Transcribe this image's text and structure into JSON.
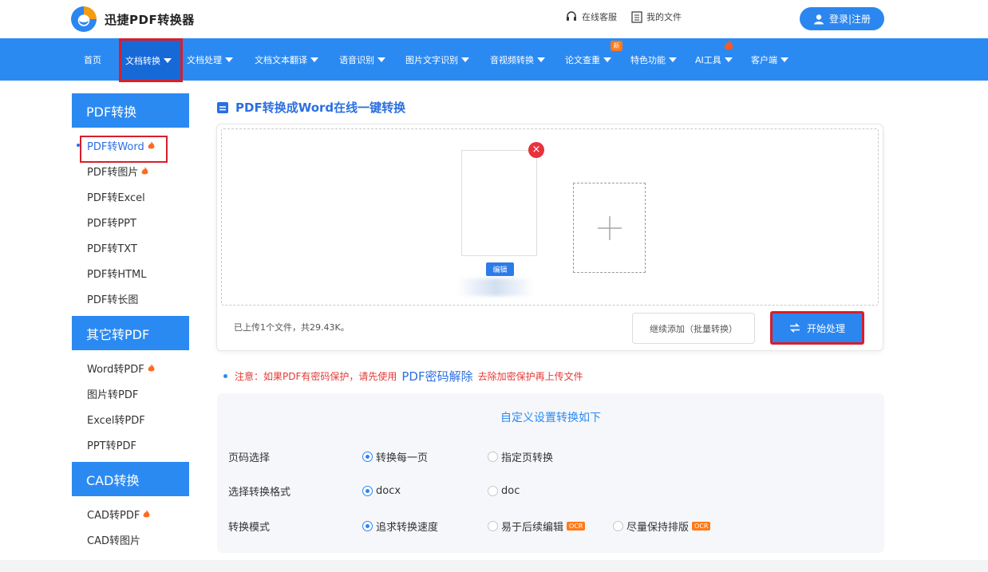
{
  "header": {
    "logo_text": "迅捷PDF转换器",
    "links": [
      {
        "label": "在线客服",
        "icon": "headset-icon"
      },
      {
        "label": "我的文件",
        "icon": "file-list-icon"
      }
    ],
    "login_label": "登录|注册"
  },
  "nav": {
    "items": [
      {
        "label": "首页",
        "caret": false
      },
      {
        "label": "文档转换",
        "caret": true,
        "active": true
      },
      {
        "label": "文档处理",
        "caret": true
      },
      {
        "label": "文档文本翻译",
        "caret": true
      },
      {
        "label": "语音识别",
        "caret": true
      },
      {
        "label": "图片文字识别",
        "caret": true
      },
      {
        "label": "音视频转换",
        "caret": true
      },
      {
        "label": "论文查重",
        "caret": true,
        "badge": "新"
      },
      {
        "label": "特色功能",
        "caret": true
      },
      {
        "label": "AI工具",
        "caret": true,
        "badge_icon": "fire-icon"
      },
      {
        "label": "客户端",
        "caret": true
      }
    ]
  },
  "sidebar": {
    "sections": [
      {
        "title": "PDF转换",
        "items": [
          {
            "label": "PDF转Word",
            "hot": true,
            "active": true
          },
          {
            "label": "PDF转图片",
            "hot": true
          },
          {
            "label": "PDF转Excel"
          },
          {
            "label": "PDF转PPT"
          },
          {
            "label": "PDF转TXT"
          },
          {
            "label": "PDF转HTML"
          },
          {
            "label": "PDF转长图"
          }
        ]
      },
      {
        "title": "其它转PDF",
        "items": [
          {
            "label": "Word转PDF",
            "hot": true
          },
          {
            "label": "图片转PDF"
          },
          {
            "label": "Excel转PDF"
          },
          {
            "label": "PPT转PDF"
          }
        ]
      },
      {
        "title": "CAD转换",
        "items": [
          {
            "label": "CAD转PDF",
            "hot": true
          },
          {
            "label": "CAD转图片"
          }
        ]
      }
    ]
  },
  "main": {
    "title": "PDF转换成Word在线一键转换",
    "edit_label": "编辑",
    "upload_info": "已上传1个文件，共29.43K。",
    "continue_label": "继续添加（批量转换）",
    "start_label": "开始处理",
    "notice_prefix": "注意：如果PDF有密码保护，请先使用",
    "notice_link": "PDF密码解除",
    "notice_suffix": "去除加密保护再上传文件"
  },
  "settings": {
    "title": "自定义设置转换如下",
    "rows": [
      {
        "label": "页码选择",
        "options": [
          {
            "label": "转换每一页",
            "selected": true
          },
          {
            "label": "指定页转换",
            "selected": false
          }
        ]
      },
      {
        "label": "选择转换格式",
        "options": [
          {
            "label": "docx",
            "selected": true
          },
          {
            "label": "doc",
            "selected": false
          }
        ]
      },
      {
        "label": "转换模式",
        "options": [
          {
            "label": "追求转换速度",
            "selected": true
          },
          {
            "label": "易于后续编辑",
            "selected": false,
            "tag": "OCR"
          },
          {
            "label": "尽量保持排版",
            "selected": false,
            "tag": "OCR"
          }
        ]
      }
    ]
  },
  "colors": {
    "primary": "#2b8af2",
    "highlight_border": "#d81e2a",
    "notice": "#e53935",
    "hot": "#ff7a1a"
  }
}
